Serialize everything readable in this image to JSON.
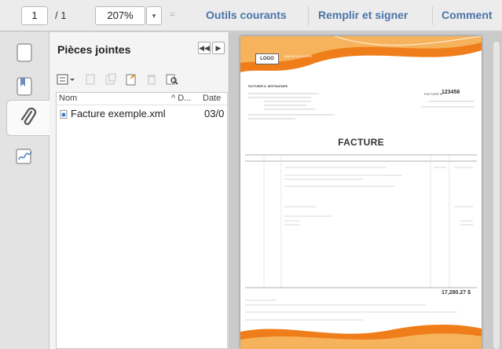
{
  "toolbar": {
    "page_current": "1",
    "page_total": "/ 1",
    "zoom": "207%",
    "zoom_dropdown": "▾",
    "separator": "=",
    "btn_tools": "Outils courants",
    "btn_fill_sign": "Remplir et signer",
    "btn_comment": "Comment"
  },
  "rail": {
    "items": [
      "pages-thumbnail-icon",
      "bookmarks-icon",
      "attachments-paperclip-icon",
      "signatures-icon"
    ],
    "active": "attachments-paperclip-icon"
  },
  "attachments_panel": {
    "title": "Pièces jointes",
    "nav_prev": "◀◀",
    "nav_next": "▶",
    "tools": [
      "options-menu-icon",
      "open-file-icon",
      "save-file-icon",
      "add-attachment-icon",
      "delete-icon",
      "search-icon"
    ],
    "columns": {
      "name": "Nom",
      "desc": "^ D...",
      "date": "Date"
    },
    "rows": [
      {
        "name": "Facture exemple.xml",
        "date": "03/0"
      }
    ]
  },
  "document": {
    "logo": "LOGO",
    "title": "FACTURE",
    "invoice_label": "FACTURE N°",
    "invoice_number": "123456",
    "total": "17,280.27 $",
    "colors": {
      "accent": "#ef7d1a",
      "accent_light": "#f7b25c"
    }
  }
}
